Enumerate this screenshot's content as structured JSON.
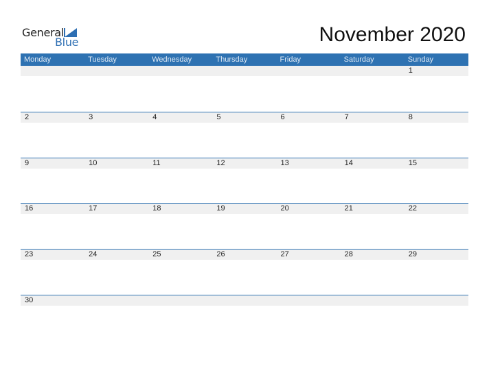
{
  "logo": {
    "general": "General",
    "blue": "Blue",
    "icon": "triangle-logo-icon",
    "accent_color": "#2e6fb3"
  },
  "title": "November 2020",
  "header_color": "#2e72b2",
  "weekdays": [
    "Monday",
    "Tuesday",
    "Wednesday",
    "Thursday",
    "Friday",
    "Saturday",
    "Sunday"
  ],
  "weeks": [
    [
      "",
      "",
      "",
      "",
      "",
      "",
      "1"
    ],
    [
      "2",
      "3",
      "4",
      "5",
      "6",
      "7",
      "8"
    ],
    [
      "9",
      "10",
      "11",
      "12",
      "13",
      "14",
      "15"
    ],
    [
      "16",
      "17",
      "18",
      "19",
      "20",
      "21",
      "22"
    ],
    [
      "23",
      "24",
      "25",
      "26",
      "27",
      "28",
      "29"
    ],
    [
      "30",
      "",
      "",
      "",
      "",
      "",
      ""
    ]
  ]
}
